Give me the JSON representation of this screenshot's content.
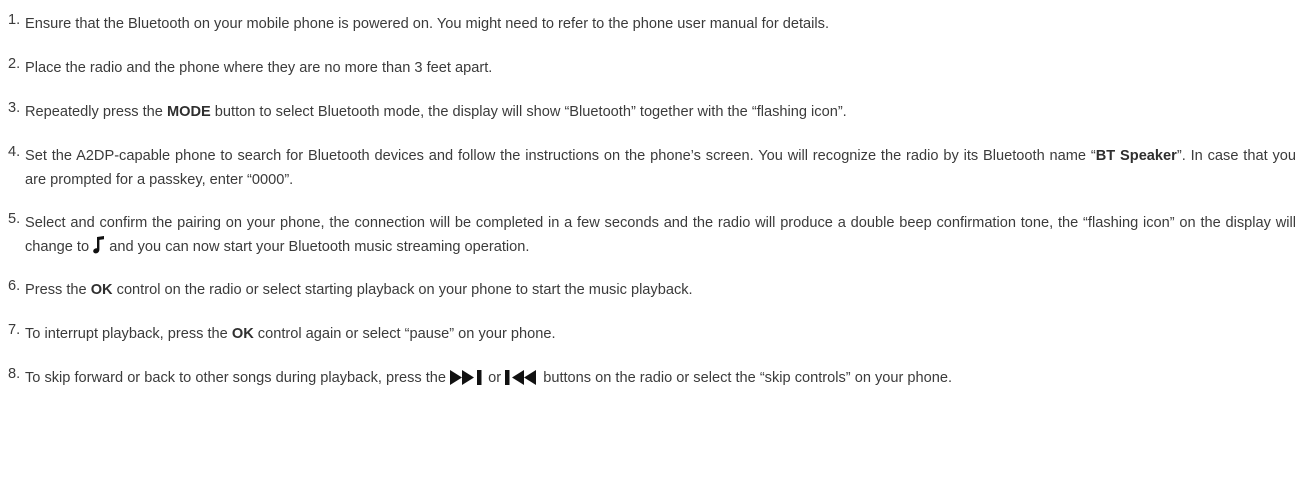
{
  "steps": [
    {
      "number": "1.",
      "text": "Ensure that the Bluetooth on your mobile phone is powered on. You might need to refer to the phone user manual for details."
    },
    {
      "number": "2.",
      "text": "Place the radio and the phone where they are no more than 3 feet apart."
    },
    {
      "number": "3.",
      "before": "Repeatedly press the ",
      "bold": "MODE",
      "after": " button to select Bluetooth mode, the display will show “Bluetooth” together with the “flashing icon”."
    },
    {
      "number": "4.",
      "before": "Set the A2DP-capable phone to search for Bluetooth devices and follow the instructions on the phone’s screen. You will recognize the radio by its Bluetooth name “",
      "bold": "BT Speaker",
      "after": "”. In case that you are prompted for a passkey, enter “0000”."
    },
    {
      "number": "5.",
      "before": "Select and confirm the pairing on your phone, the connection will be completed in a few seconds and the radio will produce a double beep confirmation tone, the “flashing icon” on the display will change to ",
      "icon": "music-note-icon",
      "after": " and you can now start your Bluetooth music streaming operation."
    },
    {
      "number": "6.",
      "before": "Press the ",
      "bold": "OK",
      "after": " control on the radio or select starting playback on your phone to start the music playback."
    },
    {
      "number": "7.",
      "before": "To interrupt playback, press the ",
      "bold": "OK",
      "after": " control again or select “pause” on your phone."
    },
    {
      "number": "8.",
      "before": "To skip forward or back to other songs during playback, press the ",
      "icon_forward": "skip-forward-icon",
      "middle": " or ",
      "icon_back": "skip-back-icon",
      "after": " buttons on the radio or select the “skip controls” on your phone."
    }
  ],
  "colors": {
    "text": "#3b3b3b",
    "icon": "#111111"
  }
}
